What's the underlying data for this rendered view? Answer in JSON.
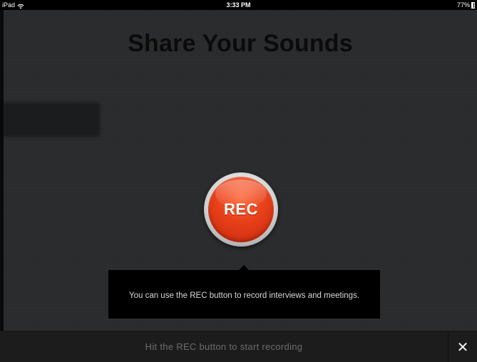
{
  "status_bar": {
    "device": "iPad",
    "wifi_icon": "wifi-icon",
    "time": "3:33 PM",
    "battery": "77%",
    "battery_icon": "battery-icon"
  },
  "main": {
    "title": "Share Your Sounds"
  },
  "rec_button": {
    "label": "REC",
    "color": "#e8401a"
  },
  "tooltip": {
    "text": "You can use the REC button to record interviews and meetings."
  },
  "bottom_bar": {
    "message": "Hit the REC button to start recording",
    "close_icon": "close-icon",
    "close_glyph": "✕"
  }
}
